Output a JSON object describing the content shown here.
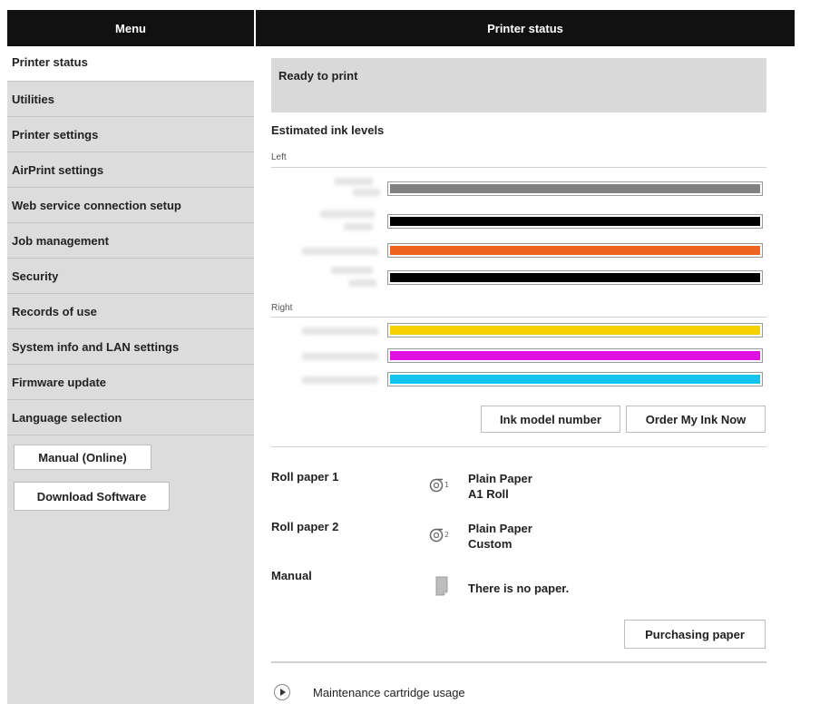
{
  "header": {
    "menu_title": "Menu",
    "page_title": "Printer status"
  },
  "sidebar": {
    "items": [
      {
        "label": "Printer status"
      },
      {
        "label": "Utilities"
      },
      {
        "label": "Printer settings"
      },
      {
        "label": "AirPrint settings"
      },
      {
        "label": "Web service connection setup"
      },
      {
        "label": "Job management"
      },
      {
        "label": "Security"
      },
      {
        "label": "Records of use"
      },
      {
        "label": "System info and LAN settings"
      },
      {
        "label": "Firmware update"
      },
      {
        "label": "Language selection"
      }
    ],
    "active_item": "Printer status",
    "manual_button": "Manual (Online)",
    "download_button": "Download Software"
  },
  "status": {
    "message": "Ready to print"
  },
  "ink": {
    "title": "Estimated ink levels",
    "left_label": "Left",
    "right_label": "Right",
    "left": [
      {
        "color": "#808080",
        "level": 1.0
      },
      {
        "color": "#000000",
        "level": 1.0
      },
      {
        "color": "#ef6320",
        "level": 1.0
      },
      {
        "color": "#000000",
        "level": 1.0
      }
    ],
    "right": [
      {
        "color": "#f7d000",
        "level": 1.0
      },
      {
        "color": "#e010e0",
        "level": 1.0
      },
      {
        "color": "#15c4ee",
        "level": 1.0
      }
    ],
    "model_button": "Ink model number",
    "order_button": "Order My Ink Now"
  },
  "paper": {
    "roll1_label": "Roll paper 1",
    "roll1_type": "Plain Paper",
    "roll1_size": "A1 Roll",
    "roll1_icon": "roll-paper-1-icon",
    "roll2_label": "Roll paper 2",
    "roll2_type": "Plain Paper",
    "roll2_size": "Custom",
    "roll2_icon": "roll-paper-2-icon",
    "manual_label": "Manual",
    "manual_status": "There is no paper.",
    "purchase_button": "Purchasing paper"
  },
  "maintenance": {
    "label": "Maintenance cartridge usage"
  }
}
